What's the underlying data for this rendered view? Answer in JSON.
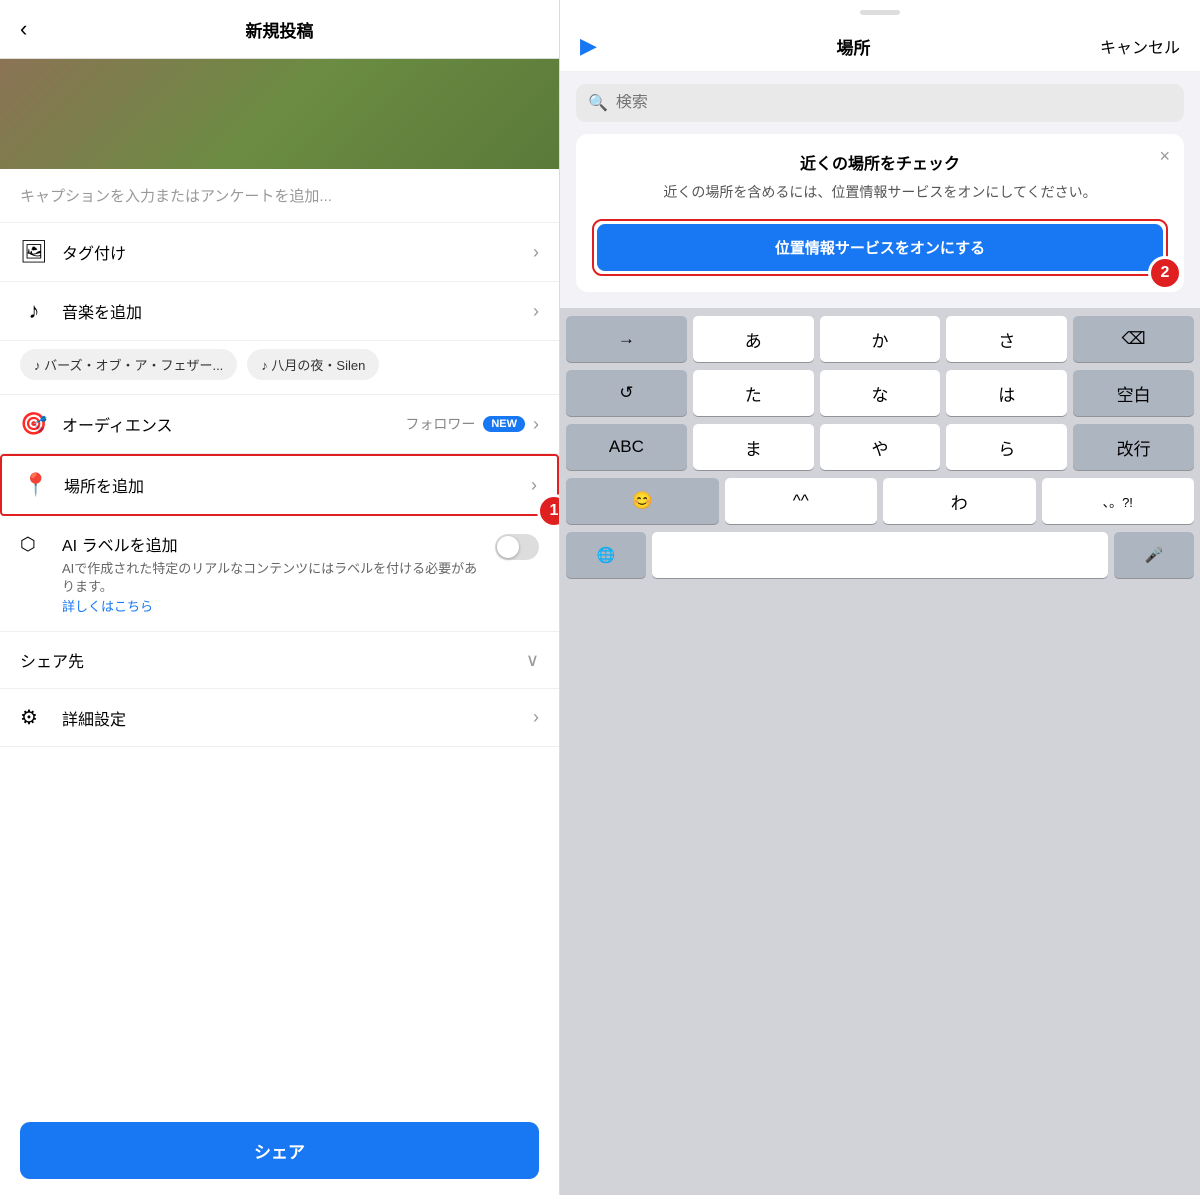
{
  "left": {
    "header": {
      "back_icon": "‹",
      "title": "新規投稿"
    },
    "caption_placeholder": "キャプションを入力またはアンケートを追加...",
    "menu_items": {
      "tag": {
        "icon": "🖼",
        "label": "タグ付け"
      },
      "music": {
        "icon": "♪",
        "label": "音楽を追加"
      },
      "music_chip1": "♪ バーズ・オブ・ア・フェザー...",
      "music_chip2": "♪ 八月の夜・Silen",
      "audience": {
        "icon": "🎯",
        "label": "オーディエンス",
        "sub": "フォロワー",
        "badge": "NEW"
      },
      "location": {
        "icon": "📍",
        "label": "場所を追加",
        "step": "1"
      },
      "ai_label": {
        "icon": "⬡",
        "title": "AI ラベルを追加",
        "desc": "AIで作成された特定のリアルなコンテンツにはラベルを付ける必要があります。",
        "link": "詳しくはこちら"
      },
      "share_dest": {
        "label": "シェア先"
      },
      "detail_settings": {
        "icon": "⚙",
        "label": "詳細設定"
      }
    },
    "share_button": "シェア"
  },
  "right": {
    "handle": true,
    "header": {
      "nav_icon": "▶",
      "title": "場所",
      "cancel": "キャンセル"
    },
    "search": {
      "placeholder": "検索"
    },
    "nearby_panel": {
      "title": "近くの場所をチェック",
      "desc": "近くの場所を含めるには、位置情報サービスをオンにしてください。",
      "close_icon": "×",
      "enable_btn": "位置情報サービスをオンにする",
      "step": "2"
    },
    "keyboard": {
      "row1": [
        "→",
        "あ",
        "か",
        "さ",
        "⌫"
      ],
      "row2": [
        "↺",
        "た",
        "な",
        "は",
        "空白"
      ],
      "row3": [
        "ABC",
        "ま",
        "や",
        "ら",
        "改行"
      ],
      "row4": [
        "😊",
        "^^",
        "わ",
        "、。?!"
      ],
      "row5_globe": "🌐",
      "row5_mic": "🎤"
    }
  }
}
